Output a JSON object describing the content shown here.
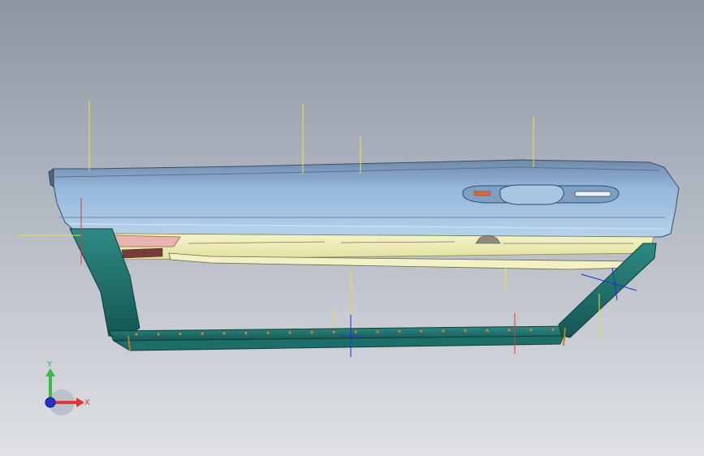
{
  "view": {
    "name": "cad-3d-viewport",
    "background_top": "#8d95a3",
    "background_bottom": "#dfe1e5"
  },
  "model": {
    "description_icon": "car-door-assembly",
    "panel_color": "#8fb3d8",
    "frame_color": "#1f6f6a",
    "liner_color": "#efeeb9",
    "marker_color": "#e8e23a"
  },
  "triad": {
    "x_label": "X",
    "y_label": "Y",
    "x_color": "#d83a3a",
    "y_color": "#3cb84a",
    "z_color": "#2233cc"
  }
}
